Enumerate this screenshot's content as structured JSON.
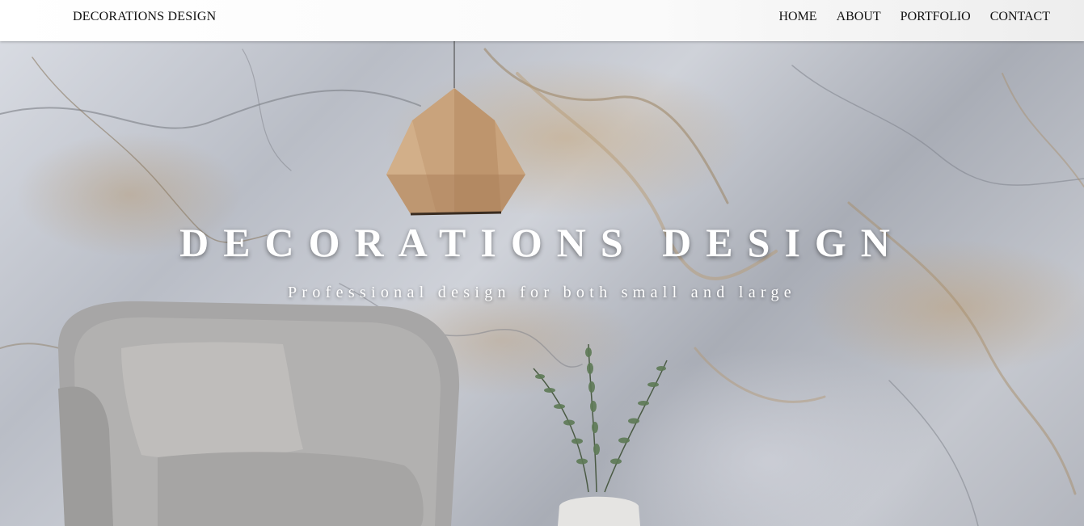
{
  "header": {
    "brand": "DECORATIONS DESIGN",
    "nav": [
      {
        "label": "HOME"
      },
      {
        "label": "ABOUT"
      },
      {
        "label": "PORTFOLIO"
      },
      {
        "label": "CONTACT"
      }
    ]
  },
  "hero": {
    "title": "DECORATIONS DESIGN",
    "subtitle": "Professional design for both small and large"
  },
  "colors": {
    "header_bg": "#ffffff",
    "hero_text": "#ffffff",
    "marble_vein": "#b89b76"
  }
}
